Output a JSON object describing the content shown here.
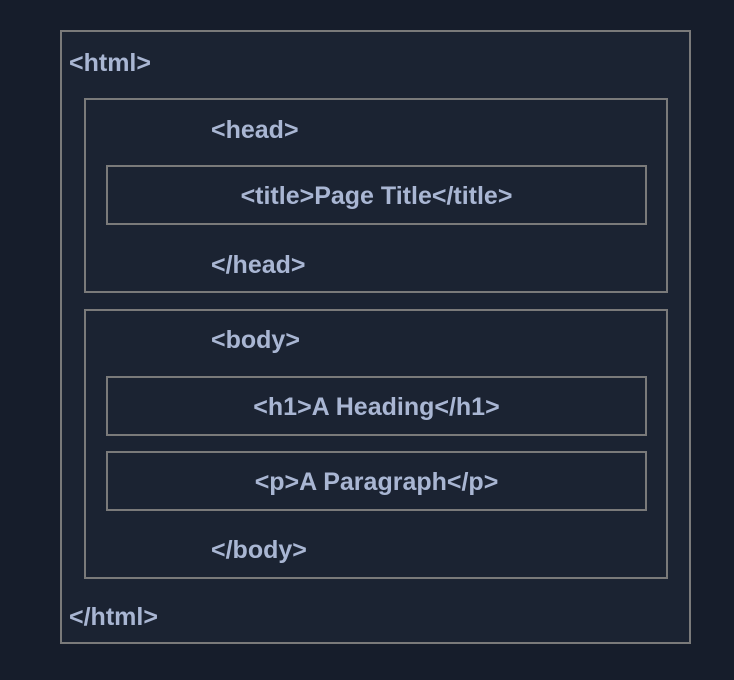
{
  "html": {
    "open": "<html>",
    "close": "</html>"
  },
  "head": {
    "open": "<head>",
    "close": "</head>",
    "children": [
      {
        "text": "<title>Page Title</title>"
      }
    ]
  },
  "body": {
    "open": "<body>",
    "close": "</body>",
    "children": [
      {
        "text": "<h1>A Heading</h1>"
      },
      {
        "text": "<p>A Paragraph</p>"
      }
    ]
  },
  "colors": {
    "background": "#161d2b",
    "box_fill": "#1b2332",
    "border": "#7a7a7a",
    "text": "#a9b6d3"
  }
}
